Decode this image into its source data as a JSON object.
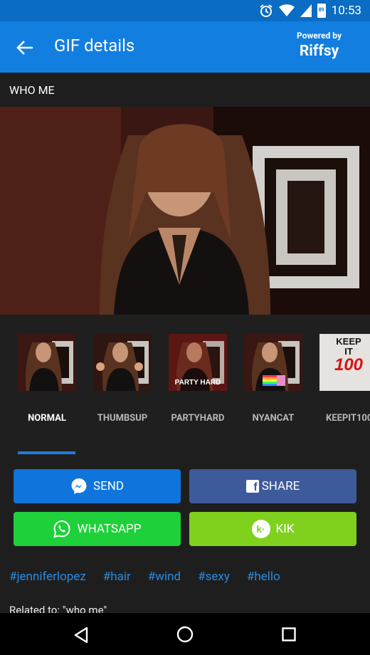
{
  "status_bar": {
    "time": "10:53",
    "icons": [
      "alarm-icon",
      "wifi-icon",
      "signal-icon",
      "battery-icon"
    ],
    "battery_label": "89"
  },
  "header": {
    "title": "GIF details",
    "powered_by": "Powered by",
    "brand": "Riffsy"
  },
  "gif": {
    "caption": "WHO ME"
  },
  "variants": [
    {
      "label": "NORMAL",
      "active": true
    },
    {
      "label": "THUMBSUP",
      "active": false
    },
    {
      "label": "PARTYHARD",
      "active": false,
      "overlay": "PARTY HARD"
    },
    {
      "label": "NYANCAT",
      "active": false
    },
    {
      "label": "KEEPIT100",
      "active": false,
      "overlay_lines": [
        "KEEP",
        "IT",
        "100"
      ]
    }
  ],
  "buttons": {
    "send": "SEND",
    "share": "SHARE",
    "whatsapp": "WHATSAPP",
    "kik": "KIK"
  },
  "tags": [
    "#jenniferlopez",
    "#hair",
    "#wind",
    "#sexy",
    "#hello"
  ],
  "related": "Related to: \"who me\"",
  "colors": {
    "status_bar": "#0a6cc2",
    "app_bar": "#127edf",
    "send": "#0f74dc",
    "share": "#3d5a9a",
    "whatsapp": "#1ed039",
    "kik": "#80d11e",
    "tag": "#2a8bdf"
  }
}
